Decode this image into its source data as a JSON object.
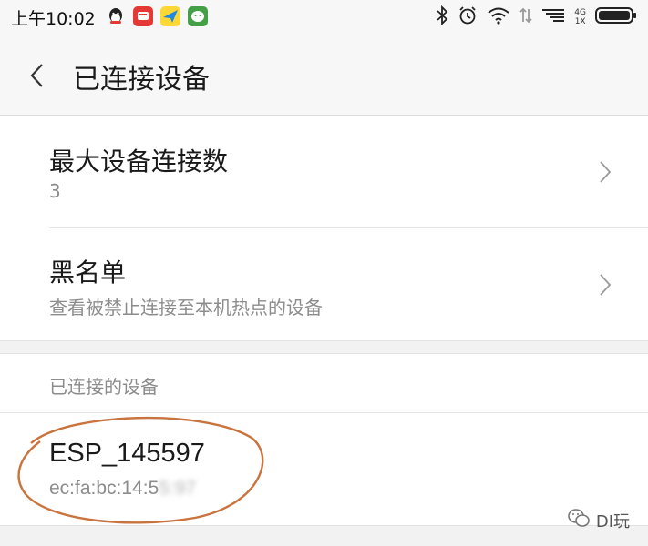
{
  "status_bar": {
    "time": "上午10:02",
    "network_type": "4G",
    "network_sub": "1X",
    "icons": [
      "qq-icon",
      "app-icon-red",
      "app-icon-paper-plane",
      "wechat-icon",
      "bluetooth-icon",
      "alarm-icon",
      "wifi-icon",
      "data-arrows-icon",
      "signal-icon",
      "battery-icon"
    ]
  },
  "header": {
    "title": "已连接设备"
  },
  "settings": {
    "max_connections": {
      "title": "最大设备连接数",
      "value": "3"
    },
    "blacklist": {
      "title": "黑名单",
      "subtitle": "查看被禁止连接至本机热点的设备"
    }
  },
  "connected": {
    "section_label": "已连接的设备",
    "device": {
      "name": "ESP_145597",
      "mac_visible": "ec:fa:bc:14:5",
      "mac_hidden": "5:97"
    }
  },
  "watermark": {
    "text": "DI玩"
  },
  "colors": {
    "ellipse": "#c9733e",
    "subtitle": "#8c8c8c",
    "background": "#f2f2f2"
  }
}
